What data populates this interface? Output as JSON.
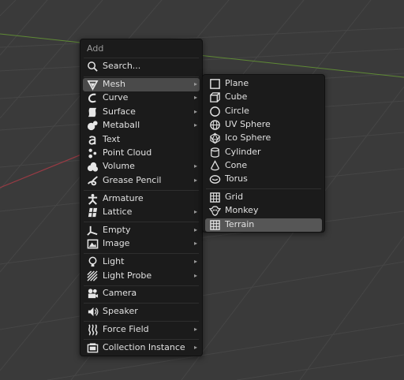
{
  "add_menu": {
    "title": "Add",
    "search_label": "Search...",
    "items": [
      {
        "label": "Mesh",
        "icon": "mesh-icon",
        "arrow": "▸"
      },
      {
        "label": "Curve",
        "icon": "curve-icon",
        "arrow": "▸"
      },
      {
        "label": "Surface",
        "icon": "surface-icon",
        "arrow": "▸"
      },
      {
        "label": "Metaball",
        "icon": "metaball-icon",
        "arrow": "▸"
      },
      {
        "label": "Text",
        "icon": "text-icon"
      },
      {
        "label": "Point Cloud",
        "icon": "point-cloud-icon"
      },
      {
        "label": "Volume",
        "icon": "volume-icon",
        "arrow": "▸"
      },
      {
        "label": "Grease Pencil",
        "icon": "grease-pencil-icon",
        "arrow": "▸"
      },
      {
        "label": "Armature",
        "icon": "armature-icon"
      },
      {
        "label": "Lattice",
        "icon": "lattice-icon",
        "arrow": "▸"
      },
      {
        "label": "Empty",
        "icon": "empty-icon",
        "arrow": "▸"
      },
      {
        "label": "Image",
        "icon": "image-icon",
        "arrow": "▸"
      },
      {
        "label": "Light",
        "icon": "light-icon",
        "arrow": "▸"
      },
      {
        "label": "Light Probe",
        "icon": "light-probe-icon",
        "arrow": "▸"
      },
      {
        "label": "Camera",
        "icon": "camera-icon"
      },
      {
        "label": "Speaker",
        "icon": "speaker-icon"
      },
      {
        "label": "Force Field",
        "icon": "force-field-icon",
        "arrow": "▸"
      },
      {
        "label": "Collection Instance",
        "icon": "collection-instance-icon",
        "arrow": "▸"
      }
    ]
  },
  "mesh_menu": {
    "items": [
      {
        "label": "Plane",
        "icon": "plane-icon"
      },
      {
        "label": "Cube",
        "icon": "cube-icon"
      },
      {
        "label": "Circle",
        "icon": "circle-icon"
      },
      {
        "label": "UV Sphere",
        "icon": "uv-sphere-icon"
      },
      {
        "label": "Ico Sphere",
        "icon": "ico-sphere-icon"
      },
      {
        "label": "Cylinder",
        "icon": "cylinder-icon"
      },
      {
        "label": "Cone",
        "icon": "cone-icon"
      },
      {
        "label": "Torus",
        "icon": "torus-icon"
      },
      {
        "label": "Grid",
        "icon": "grid-icon"
      },
      {
        "label": "Monkey",
        "icon": "monkey-icon"
      },
      {
        "label": "Terrain",
        "icon": "terrain-icon"
      }
    ]
  },
  "colors": {
    "viewport_bg": "#3a3a3a",
    "menu_bg": "#1b1b1b",
    "highlight": "#4a4a4a",
    "x_axis": "#9a3a44",
    "y_axis": "#5f8a35"
  }
}
